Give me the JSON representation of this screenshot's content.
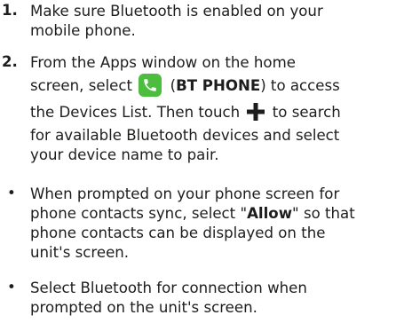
{
  "steps": [
    {
      "number": "1.",
      "lines": [
        "Make sure Bluetooth is enabled on your",
        "mobile phone."
      ]
    },
    {
      "number": "2.",
      "line1": "From the Apps window on the home",
      "line2_a": "screen, select",
      "line2_b": "(",
      "line2_bold": "BT PHONE",
      "line2_c": ") to access",
      "line3_a": "the Devices List. Then touch",
      "line3_b": "to search",
      "line4": "for available Bluetooth devices and select",
      "line5": "your device name to pair."
    }
  ],
  "bullets": [
    {
      "line1": "When prompted on your phone screen for",
      "line2_a": "phone contacts sync, select \"",
      "line2_bold": "Allow",
      "line2_b": "\" so that",
      "line3": "phone contacts can be displayed on the",
      "line4": "unit's screen."
    },
    {
      "line1": "Select Bluetooth for connection when",
      "line2": "prompted on the unit's screen."
    }
  ],
  "icons": {
    "app_icon": "phone-app-icon",
    "plus_icon": "plus-icon",
    "app_icon_color": "#4cbd3f",
    "text_color": "#1d1d1b"
  }
}
